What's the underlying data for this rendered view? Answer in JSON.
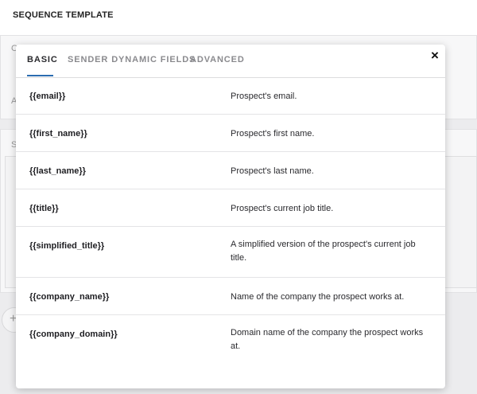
{
  "page": {
    "title": "SEQUENCE TEMPLATE"
  },
  "background_fragments": {
    "frag_c": "C",
    "frag_a": "A",
    "frag_s": "S",
    "plus": "+"
  },
  "modal": {
    "tabs": [
      {
        "label": "BASIC",
        "active": true
      },
      {
        "label": "SENDER DYNAMIC FIELDS",
        "active": false
      },
      {
        "label": "ADVANCED",
        "active": false
      }
    ],
    "close_label": "×",
    "rows": [
      {
        "field": "{{email}}",
        "description": "Prospect's email."
      },
      {
        "field": "{{first_name}}",
        "description": "Prospect's first name."
      },
      {
        "field": "{{last_name}}",
        "description": "Prospect's last name."
      },
      {
        "field": "{{title}}",
        "description": "Prospect's current job title."
      },
      {
        "field": "{{simplified_title}}",
        "description": "A simplified version of the prospect's current job title."
      },
      {
        "field": "{{company_name}}",
        "description": "Name of the company the prospect works at."
      },
      {
        "field": "{{company_domain}}",
        "description": "Domain name of the company the prospect works at."
      }
    ]
  },
  "colors": {
    "active_tab_underline": "#2b6cb0",
    "backdrop": "#ececee"
  }
}
